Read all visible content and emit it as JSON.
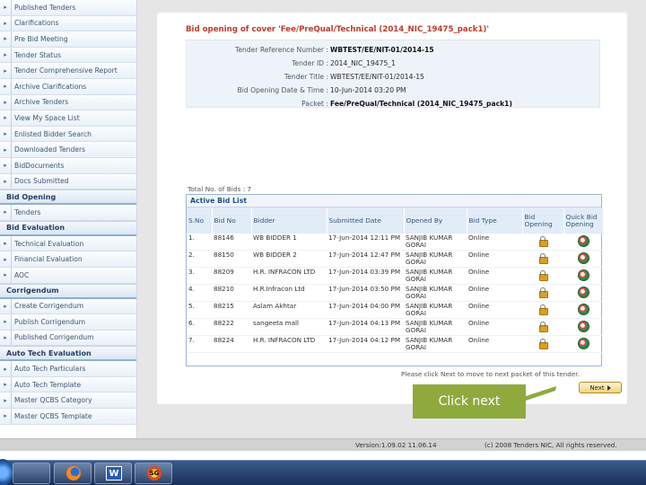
{
  "sidebar": {
    "groups": [
      {
        "heading": null,
        "items": [
          "Published Tenders",
          "Clarifications",
          "Pre Bid Meeting",
          "Tender Status",
          "Tender Comprehensive Report",
          "Archive Clarifications",
          "Archive Tenders",
          "View My Space List",
          "Enlisted Bidder Search",
          "Downloaded Tenders",
          "BidDocuments",
          "Docs Submitted"
        ]
      },
      {
        "heading": "Bid Opening",
        "items": [
          "Tenders"
        ]
      },
      {
        "heading": "Bid Evaluation",
        "items": [
          "Technical Evaluation",
          "Financial Evaluation",
          "AOC"
        ]
      },
      {
        "heading": "Corrigendum",
        "items": [
          "Create Corrigendum",
          "Publish Corrigendum",
          "Published Corrigendum"
        ]
      },
      {
        "heading": "Auto Tech Evaluation",
        "items": [
          "Auto Tech Particulars",
          "Auto Tech Template",
          "Master QCBS Category",
          "Master QCBS Template"
        ]
      }
    ]
  },
  "bid_opening": {
    "title": "Bid opening of cover 'Fee/PreQual/Technical (2014_NIC_19475_pack1)'",
    "details": [
      {
        "key": "Tender Reference Number :",
        "value": "WBTEST/EE/NIT-01/2014-15",
        "bold": true
      },
      {
        "key": "Tender ID :",
        "value": "2014_NIC_19475_1",
        "bold": false
      },
      {
        "key": "Tender Title :",
        "value": "WBTEST/EE/NIT-01/2014-15",
        "bold": false
      },
      {
        "key": "Bid Opening Date & Time :",
        "value": "10-Jun-2014 03:20 PM",
        "bold": false
      },
      {
        "key": "Packet :",
        "value": "Fee/PreQual/Technical (2014_NIC_19475_pack1)",
        "bold": true
      }
    ],
    "total_bids": "Total No. of Bids : 7",
    "list_title": "Active Bid List",
    "columns": [
      "S.No",
      "Bid No",
      "Bidder",
      "Submitted Date",
      "Opened By",
      "Bid Type",
      "Bid Opening",
      "Quick Bid Opening"
    ],
    "rows": [
      {
        "sno": "1.",
        "bid_no": "88146",
        "bidder": "WB BIDDER 1",
        "date": "17-Jun-2014 12:11 PM",
        "opened_by": "SANJIB KUMAR GORAI",
        "type": "Online"
      },
      {
        "sno": "2.",
        "bid_no": "88150",
        "bidder": "WB BIDDER 2",
        "date": "17-Jun-2014 12:47 PM",
        "opened_by": "SANJIB KUMAR GORAI",
        "type": "Online"
      },
      {
        "sno": "3.",
        "bid_no": "88209",
        "bidder": "H.R. INFRACON LTD",
        "date": "17-Jun-2014 03:39 PM",
        "opened_by": "SANJIB KUMAR GORAI",
        "type": "Online"
      },
      {
        "sno": "4.",
        "bid_no": "88210",
        "bidder": "H.R.Infracon Ltd",
        "date": "17-Jun-2014 03:50 PM",
        "opened_by": "SANJIB KUMAR GORAI",
        "type": "Online"
      },
      {
        "sno": "5.",
        "bid_no": "88215",
        "bidder": "Aslam Akhtar",
        "date": "17-Jun-2014 04:00 PM",
        "opened_by": "SANJIB KUMAR GORAI",
        "type": "Online"
      },
      {
        "sno": "6.",
        "bid_no": "88222",
        "bidder": "sangeeta mall",
        "date": "17-Jun-2014 04:13 PM",
        "opened_by": "SANJIB KUMAR GORAI",
        "type": "Online"
      },
      {
        "sno": "7.",
        "bid_no": "88224",
        "bidder": "H.R. INFRACON LTD",
        "date": "17-Jun-2014 04:12 PM",
        "opened_by": "SANJIB KUMAR GORAI",
        "type": "Online"
      }
    ],
    "next_message": "Please click Next to move to next packet of this tender.",
    "next_label": "Next"
  },
  "footer": {
    "version": "Version:1.09.02 11.06.14",
    "copyright": "(c) 2008 Tenders NIC, All rights reserved."
  },
  "callout": {
    "text": "Click next"
  },
  "taskbar": {
    "word_letter": "W",
    "snagit_letter": "SG"
  },
  "colors": {
    "title_red": "#c0392b",
    "callout_green": "#8faa3c",
    "header_blue": "#1f4f86"
  }
}
